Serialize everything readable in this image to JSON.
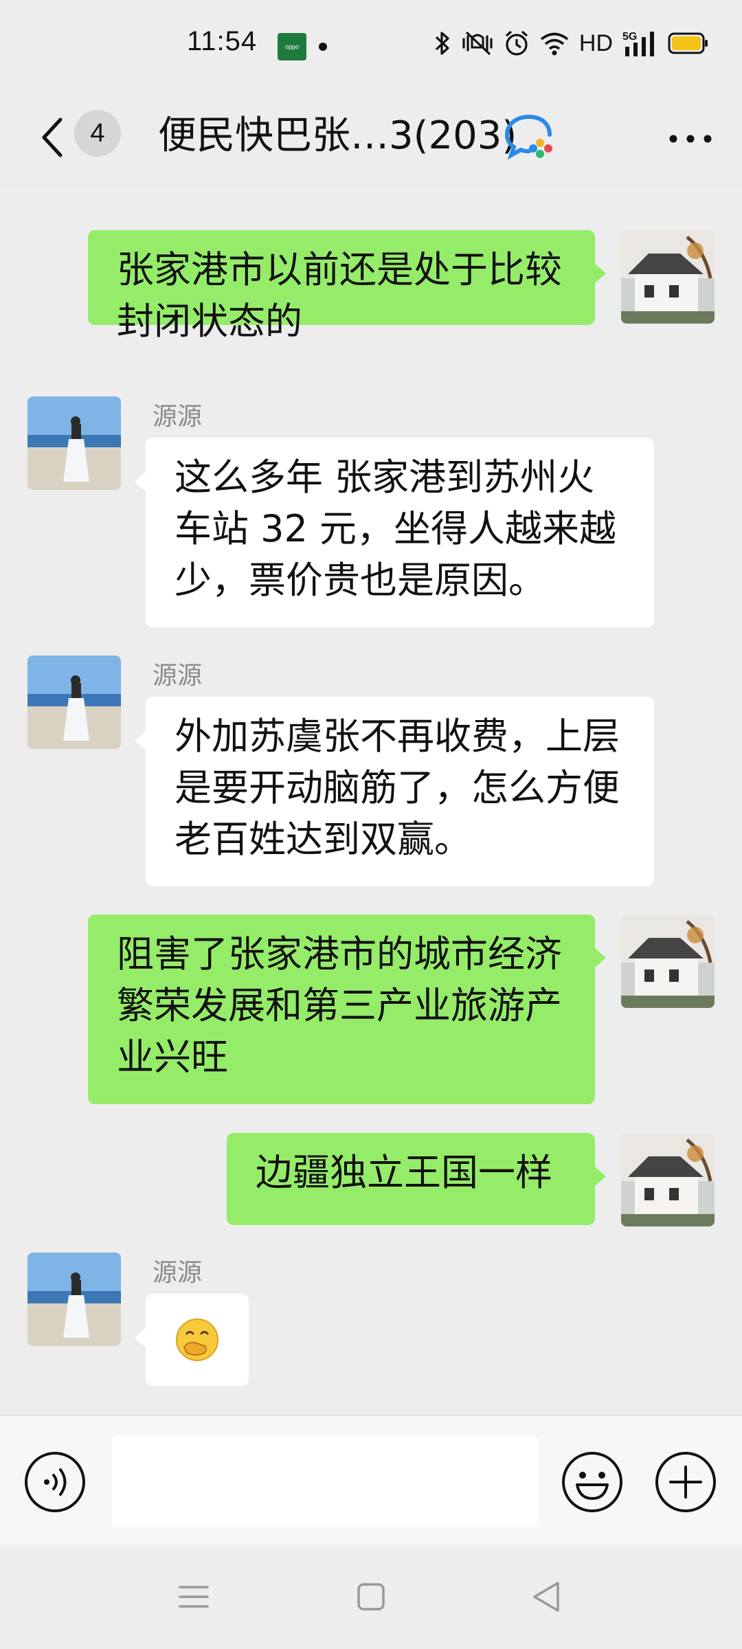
{
  "status_bar": {
    "time": "11:54",
    "carrier_icon": "oppo-app-icon",
    "network_label": "HD",
    "signal_label": "5G",
    "icons": [
      "bluetooth-icon",
      "mute-icon",
      "alarm-icon",
      "wifi-icon",
      "signal-icon",
      "battery-icon"
    ]
  },
  "header": {
    "back_icon": "back-chevron-icon",
    "unread_count": "4",
    "title": "便民快巴张…3(203)",
    "title_icon": "group-chat-icon",
    "more_icon": "more-dots-icon"
  },
  "messages": [
    {
      "side": "out",
      "text_lines": [
        "张家港市以前还是处于比较",
        "封闭状态的"
      ]
    },
    {
      "side": "in",
      "sender": "源源",
      "text_lines": [
        "这么多年 张家港到苏州火",
        "车站 32 元，坐得人越来越",
        "少，票价贵也是原因。"
      ]
    },
    {
      "side": "in",
      "sender": "源源",
      "text_lines": [
        "外加苏虞张不再收费，上层",
        "是要开动脑筋了，怎么方便",
        "老百姓达到双赢。"
      ]
    },
    {
      "side": "out",
      "text_lines": [
        "阻害了张家港市的城市经济",
        "繁荣发展和第三产业旅游产",
        "业兴旺"
      ]
    },
    {
      "side": "out",
      "text_lines": [
        "边疆独立王国一样"
      ]
    },
    {
      "side": "in",
      "sender": "源源",
      "emoji": "🤭"
    }
  ],
  "input_bar": {
    "voice_icon": "voice-icon",
    "text_value": "",
    "emoji_icon": "emoji-icon",
    "plus_icon": "plus-icon"
  },
  "nav_bar": {
    "icons": [
      "menu-nav-icon",
      "home-nav-icon",
      "back-nav-icon"
    ]
  },
  "colors": {
    "bubble_out": "#95ec69",
    "bubble_in": "#ffffff",
    "background": "#ededed",
    "sender_name": "#8a8a8a"
  }
}
